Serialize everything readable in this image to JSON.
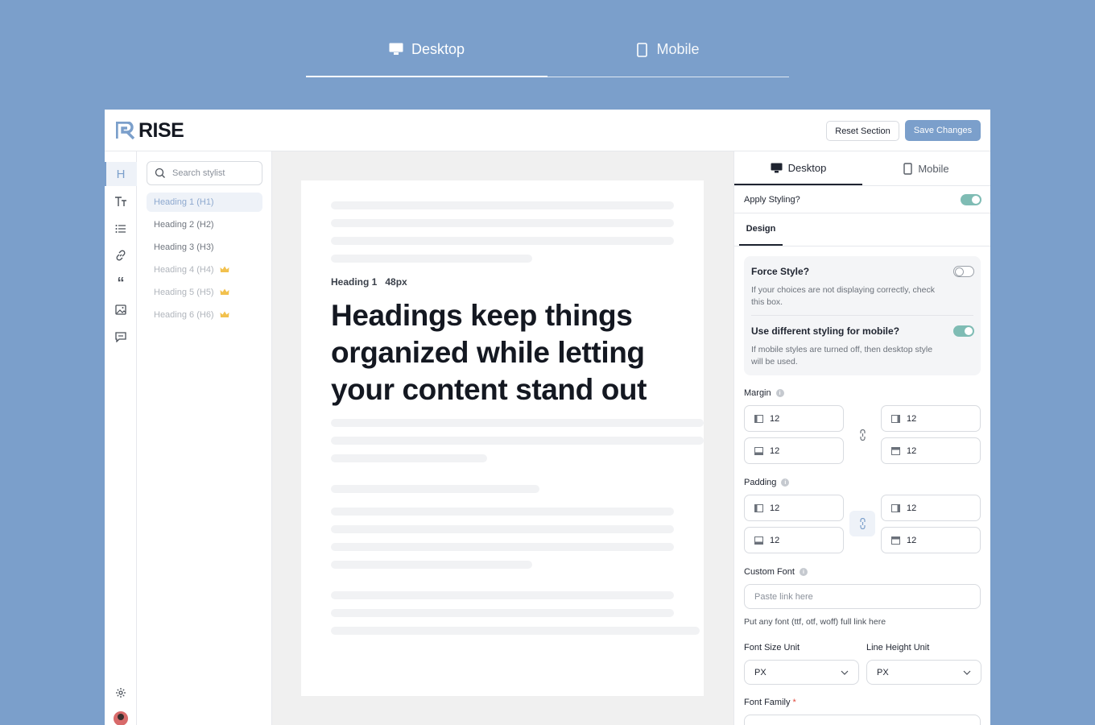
{
  "device_tabs": [
    {
      "label": "Desktop",
      "icon": "monitor-icon",
      "active": true
    },
    {
      "label": "Mobile",
      "icon": "phone-icon",
      "active": false
    }
  ],
  "header": {
    "logo_text": "RISE",
    "reset_label": "Reset Section",
    "save_label": "Save Changes"
  },
  "rail": {
    "items": [
      "heading-icon",
      "text-size-icon",
      "list-icon",
      "link-icon",
      "quote-icon",
      "image-icon",
      "comment-icon"
    ],
    "bottom": [
      "settings-icon",
      "avatar"
    ]
  },
  "stylist": {
    "search_placeholder": "Search stylist",
    "items": [
      {
        "label": "Heading 1 (H1)",
        "premium": false
      },
      {
        "label": "Heading 2 (H2)",
        "premium": false
      },
      {
        "label": "Heading 3 (H3)",
        "premium": false
      },
      {
        "label": "Heading 4 (H4)",
        "premium": true
      },
      {
        "label": "Heading 5 (H5)",
        "premium": true
      },
      {
        "label": "Heading 6 (H6)",
        "premium": true
      }
    ]
  },
  "preview": {
    "tag": "Heading 1",
    "size": "48px",
    "headline": "Headings keep things organized while letting your content stand out"
  },
  "settings": {
    "tabs": [
      {
        "label": "Desktop",
        "icon": "monitor-icon"
      },
      {
        "label": "Mobile",
        "icon": "phone-icon"
      }
    ],
    "apply_label": "Apply Styling?",
    "apply_on": true,
    "design_tab": "Design",
    "force_title": "Force Style?",
    "force_desc": "If your choices are not displaying correctly, check this box.",
    "force_on": false,
    "mobile_title": "Use different styling for mobile?",
    "mobile_desc": "If mobile styles are turned off, then desktop style will be used.",
    "mobile_on": true,
    "margin_label": "Margin",
    "margin": {
      "left": "12",
      "right": "12",
      "bottom": "12",
      "top": "12"
    },
    "padding_label": "Padding",
    "padding": {
      "left": "12",
      "right": "12",
      "bottom": "12",
      "top": "12"
    },
    "custom_font_label": "Custom Font",
    "custom_font_placeholder": "Paste link here",
    "custom_font_help": "Put any font (ttf, otf, woff) full link here",
    "font_size_unit_label": "Font Size Unit",
    "font_size_unit_value": "PX",
    "line_height_unit_label": "Line Height Unit",
    "line_height_unit_value": "PX",
    "font_family_label": "Font Family",
    "required_mark": "*"
  },
  "colors": {
    "accent": "#7b9fcb",
    "toggle_on": "#7fbcb4",
    "premium": "#f2c14e"
  }
}
